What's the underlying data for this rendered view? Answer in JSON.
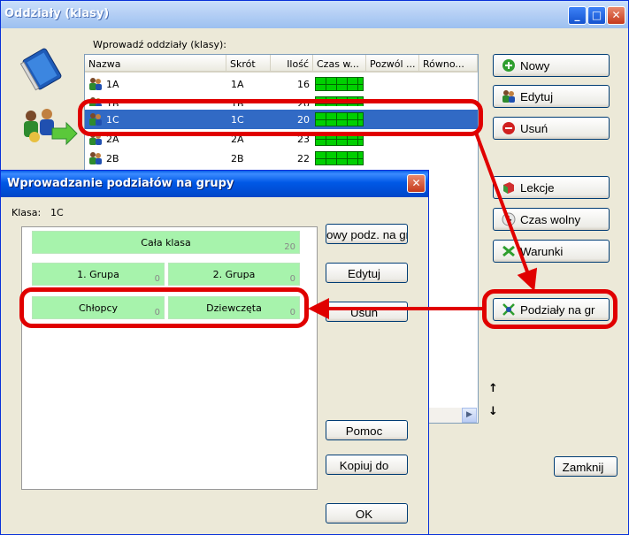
{
  "window": {
    "title": "Oddziały (klasy)"
  },
  "list": {
    "label": "Wprowadź oddziały (klasy):",
    "columns": [
      "Nazwa",
      "Skrót",
      "Ilość",
      "Czas w...",
      "Pozwól ...",
      "Równo..."
    ],
    "rows": [
      {
        "name": "1A",
        "short": "1A",
        "count": "16"
      },
      {
        "name": "1B",
        "short": "1B",
        "count": "20"
      },
      {
        "name": "1C",
        "short": "1C",
        "count": "20"
      },
      {
        "name": "2A",
        "short": "2A",
        "count": "23"
      },
      {
        "name": "2B",
        "short": "2B",
        "count": "22"
      }
    ]
  },
  "buttons": {
    "new": "Nowy",
    "edit": "Edytuj",
    "delete": "Usuń",
    "lessons": "Lekcje",
    "free_time": "Czas wolny",
    "conditions": "Warunki",
    "group_divisions": "Podziały na gr",
    "up": "↑",
    "down": "↓",
    "close": "Zamknij"
  },
  "dialog": {
    "title": "Wprowadzanie podziałów na grupy",
    "class_label": "Klasa:",
    "class_value": "1C",
    "groups": {
      "whole": {
        "label": "Cała klasa",
        "count": "20"
      },
      "group1": {
        "label": "1. Grupa",
        "count": "0"
      },
      "group2": {
        "label": "2. Grupa",
        "count": "0"
      },
      "boys": {
        "label": "Chłopcy",
        "count": "0"
      },
      "girls": {
        "label": "Dziewczęta",
        "count": "0"
      }
    },
    "buttons": {
      "new_division": "owy podz. na grup",
      "edit": "Edytuj",
      "delete": "Usuń",
      "help": "Pomoc",
      "copy_to": "Kopiuj do",
      "ok": "OK"
    }
  }
}
